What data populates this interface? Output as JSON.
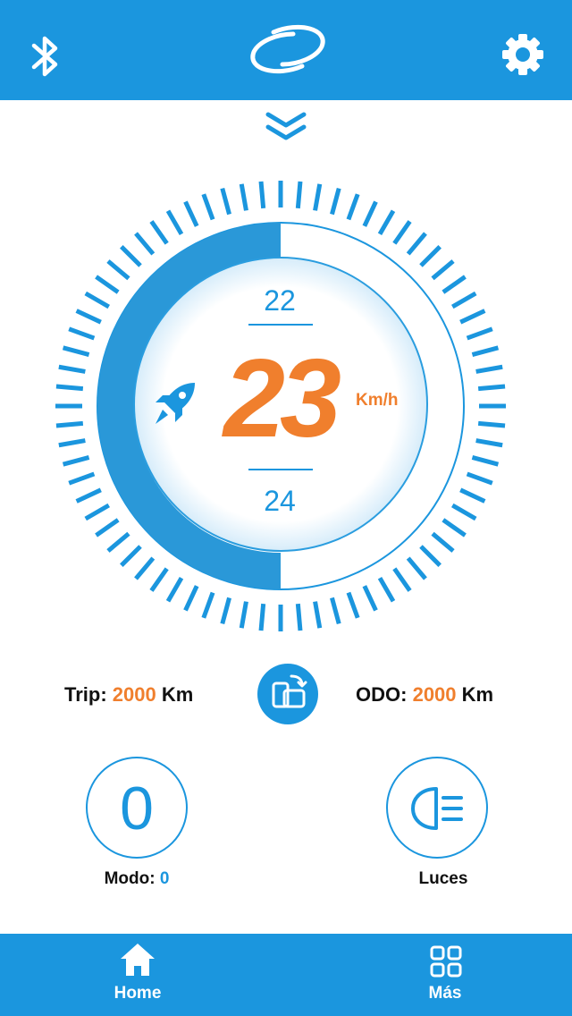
{
  "header": {
    "left_icon": "bluetooth-icon",
    "center_logo": "brand-logo",
    "right_icon": "gear-icon"
  },
  "collapse_icon": "double-chevron-down-icon",
  "gauge": {
    "level_fraction": 0.5,
    "accent_color": "#1b96de",
    "speed_color": "#f07f2d",
    "prev_speed": "22",
    "speed": "23",
    "unit": "Km/h",
    "next_speed": "24",
    "mode_icon": "rocket-icon"
  },
  "trip": {
    "label": "Trip:",
    "value": "2000",
    "unit": "Km"
  },
  "odo": {
    "label": "ODO:",
    "value": "2000",
    "unit": "Km"
  },
  "swap_icon": "phone-swap-icon",
  "modo": {
    "digit": "0",
    "label": "Modo:",
    "value": "0"
  },
  "luces": {
    "label": "Luces",
    "icon": "headlight-icon"
  },
  "nav": [
    {
      "label": "Home",
      "icon": "home-icon"
    },
    {
      "label": "Más",
      "icon": "grid-icon"
    }
  ]
}
